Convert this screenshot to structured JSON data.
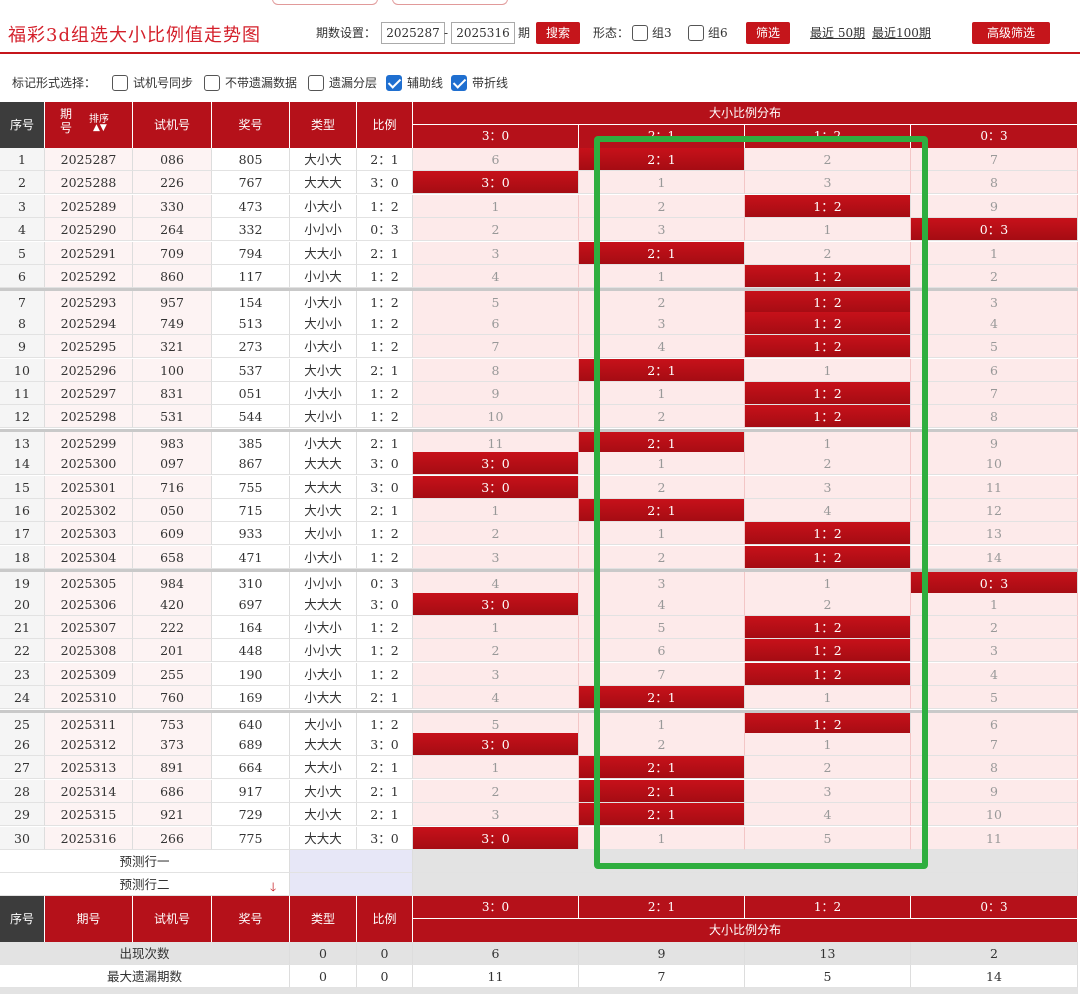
{
  "page_title": "福彩3d组选大小比例值走势图",
  "controls": {
    "period_label": "期数设置：",
    "period_from": "2025287",
    "dash": "-",
    "period_to": "2025316",
    "period_unit": "期",
    "search_label": "搜索",
    "form_label": "形态：",
    "group3_label": "组3",
    "group6_label": "组6",
    "filter_label": "筛选",
    "recent50_label": "最近 50期",
    "recent100_label": "最近100期",
    "advanced_label": "高级筛选"
  },
  "mark_options": {
    "label": "标记形式选择：",
    "items": [
      {
        "label": "试机号同步",
        "checked": false
      },
      {
        "label": "不带遗漏数据",
        "checked": false
      },
      {
        "label": "遗漏分层",
        "checked": false
      },
      {
        "label": "辅助线",
        "checked": true
      },
      {
        "label": "带折线",
        "checked": true
      }
    ]
  },
  "table": {
    "headers": {
      "seq": "序号",
      "period": "期号",
      "sort": "排序",
      "test": "试机号",
      "prize": "奖号",
      "type": "类型",
      "ratio": "比例",
      "dist_title": "大小比例分布",
      "dist_cols": [
        "3：0",
        "2：1",
        "1：2",
        "0：3"
      ]
    },
    "rows": [
      {
        "seq": "1",
        "period": "2025287",
        "test": "086",
        "prize": "805",
        "type": "大小大",
        "ratio": "2：1",
        "d": [
          "6",
          "2：1",
          "2",
          "7"
        ],
        "hit": 1
      },
      {
        "seq": "2",
        "period": "2025288",
        "test": "226",
        "prize": "767",
        "type": "大大大",
        "ratio": "3：0",
        "d": [
          "3：0",
          "1",
          "3",
          "8"
        ],
        "hit": 0
      },
      {
        "seq": "3",
        "period": "2025289",
        "test": "330",
        "prize": "473",
        "type": "小大小",
        "ratio": "1：2",
        "d": [
          "1",
          "2",
          "1：2",
          "9"
        ],
        "hit": 2
      },
      {
        "seq": "4",
        "period": "2025290",
        "test": "264",
        "prize": "332",
        "type": "小小小",
        "ratio": "0：3",
        "d": [
          "2",
          "3",
          "1",
          "0：3"
        ],
        "hit": 3
      },
      {
        "seq": "5",
        "period": "2025291",
        "test": "709",
        "prize": "794",
        "type": "大大小",
        "ratio": "2：1",
        "d": [
          "3",
          "2：1",
          "2",
          "1"
        ],
        "hit": 1
      },
      {
        "seq": "6",
        "period": "2025292",
        "test": "860",
        "prize": "117",
        "type": "小小大",
        "ratio": "1：2",
        "d": [
          "4",
          "1",
          "1：2",
          "2"
        ],
        "hit": 2
      },
      {
        "seq": "7",
        "period": "2025293",
        "test": "957",
        "prize": "154",
        "type": "小大小",
        "ratio": "1：2",
        "d": [
          "5",
          "2",
          "1：2",
          "3"
        ],
        "hit": 2
      },
      {
        "seq": "8",
        "period": "2025294",
        "test": "749",
        "prize": "513",
        "type": "大小小",
        "ratio": "1：2",
        "d": [
          "6",
          "3",
          "1：2",
          "4"
        ],
        "hit": 2
      },
      {
        "seq": "9",
        "period": "2025295",
        "test": "321",
        "prize": "273",
        "type": "小大小",
        "ratio": "1：2",
        "d": [
          "7",
          "4",
          "1：2",
          "5"
        ],
        "hit": 2
      },
      {
        "seq": "10",
        "period": "2025296",
        "test": "100",
        "prize": "537",
        "type": "大小大",
        "ratio": "2：1",
        "d": [
          "8",
          "2：1",
          "1",
          "6"
        ],
        "hit": 1
      },
      {
        "seq": "11",
        "period": "2025297",
        "test": "831",
        "prize": "051",
        "type": "小大小",
        "ratio": "1：2",
        "d": [
          "9",
          "1",
          "1：2",
          "7"
        ],
        "hit": 2
      },
      {
        "seq": "12",
        "period": "2025298",
        "test": "531",
        "prize": "544",
        "type": "大小小",
        "ratio": "1：2",
        "d": [
          "10",
          "2",
          "1：2",
          "8"
        ],
        "hit": 2
      },
      {
        "seq": "13",
        "period": "2025299",
        "test": "983",
        "prize": "385",
        "type": "小大大",
        "ratio": "2：1",
        "d": [
          "11",
          "2：1",
          "1",
          "9"
        ],
        "hit": 1
      },
      {
        "seq": "14",
        "period": "2025300",
        "test": "097",
        "prize": "867",
        "type": "大大大",
        "ratio": "3：0",
        "d": [
          "3：0",
          "1",
          "2",
          "10"
        ],
        "hit": 0
      },
      {
        "seq": "15",
        "period": "2025301",
        "test": "716",
        "prize": "755",
        "type": "大大大",
        "ratio": "3：0",
        "d": [
          "3：0",
          "2",
          "3",
          "11"
        ],
        "hit": 0
      },
      {
        "seq": "16",
        "period": "2025302",
        "test": "050",
        "prize": "715",
        "type": "大小大",
        "ratio": "2：1",
        "d": [
          "1",
          "2：1",
          "4",
          "12"
        ],
        "hit": 1
      },
      {
        "seq": "17",
        "period": "2025303",
        "test": "609",
        "prize": "933",
        "type": "大小小",
        "ratio": "1：2",
        "d": [
          "2",
          "1",
          "1：2",
          "13"
        ],
        "hit": 2
      },
      {
        "seq": "18",
        "period": "2025304",
        "test": "658",
        "prize": "471",
        "type": "小大小",
        "ratio": "1：2",
        "d": [
          "3",
          "2",
          "1：2",
          "14"
        ],
        "hit": 2
      },
      {
        "seq": "19",
        "period": "2025305",
        "test": "984",
        "prize": "310",
        "type": "小小小",
        "ratio": "0：3",
        "d": [
          "4",
          "3",
          "1",
          "0：3"
        ],
        "hit": 3
      },
      {
        "seq": "20",
        "period": "2025306",
        "test": "420",
        "prize": "697",
        "type": "大大大",
        "ratio": "3：0",
        "d": [
          "3：0",
          "4",
          "2",
          "1"
        ],
        "hit": 0
      },
      {
        "seq": "21",
        "period": "2025307",
        "test": "222",
        "prize": "164",
        "type": "小大小",
        "ratio": "1：2",
        "d": [
          "1",
          "5",
          "1：2",
          "2"
        ],
        "hit": 2
      },
      {
        "seq": "22",
        "period": "2025308",
        "test": "201",
        "prize": "448",
        "type": "小小大",
        "ratio": "1：2",
        "d": [
          "2",
          "6",
          "1：2",
          "3"
        ],
        "hit": 2
      },
      {
        "seq": "23",
        "period": "2025309",
        "test": "255",
        "prize": "190",
        "type": "小大小",
        "ratio": "1：2",
        "d": [
          "3",
          "7",
          "1：2",
          "4"
        ],
        "hit": 2
      },
      {
        "seq": "24",
        "period": "2025310",
        "test": "760",
        "prize": "169",
        "type": "小大大",
        "ratio": "2：1",
        "d": [
          "4",
          "2：1",
          "1",
          "5"
        ],
        "hit": 1
      },
      {
        "seq": "25",
        "period": "2025311",
        "test": "753",
        "prize": "640",
        "type": "大小小",
        "ratio": "1：2",
        "d": [
          "5",
          "1",
          "1：2",
          "6"
        ],
        "hit": 2
      },
      {
        "seq": "26",
        "period": "2025312",
        "test": "373",
        "prize": "689",
        "type": "大大大",
        "ratio": "3：0",
        "d": [
          "3：0",
          "2",
          "1",
          "7"
        ],
        "hit": 0
      },
      {
        "seq": "27",
        "period": "2025313",
        "test": "891",
        "prize": "664",
        "type": "大大小",
        "ratio": "2：1",
        "d": [
          "1",
          "2：1",
          "2",
          "8"
        ],
        "hit": 1
      },
      {
        "seq": "28",
        "period": "2025314",
        "test": "686",
        "prize": "917",
        "type": "大小大",
        "ratio": "2：1",
        "d": [
          "2",
          "2：1",
          "3",
          "9"
        ],
        "hit": 1
      },
      {
        "seq": "29",
        "period": "2025315",
        "test": "921",
        "prize": "729",
        "type": "大小大",
        "ratio": "2：1",
        "d": [
          "3",
          "2：1",
          "4",
          "10"
        ],
        "hit": 1
      },
      {
        "seq": "30",
        "period": "2025316",
        "test": "266",
        "prize": "775",
        "type": "大大大",
        "ratio": "3：0",
        "d": [
          "3：0",
          "1",
          "5",
          "11"
        ],
        "hit": 0
      }
    ],
    "predict_rows": [
      "预测行一",
      "预测行二"
    ],
    "stats": [
      {
        "label": "出现次数",
        "type": "0",
        "ratio": "0",
        "d": [
          "6",
          "9",
          "13",
          "2"
        ]
      },
      {
        "label": "最大遗漏期数",
        "type": "0",
        "ratio": "0",
        "d": [
          "11",
          "7",
          "5",
          "14"
        ]
      }
    ]
  },
  "colors": {
    "brand_red": "#c5151b",
    "highlight_green": "#2fae3f",
    "checkbox_blue": "#1f6fd0"
  }
}
